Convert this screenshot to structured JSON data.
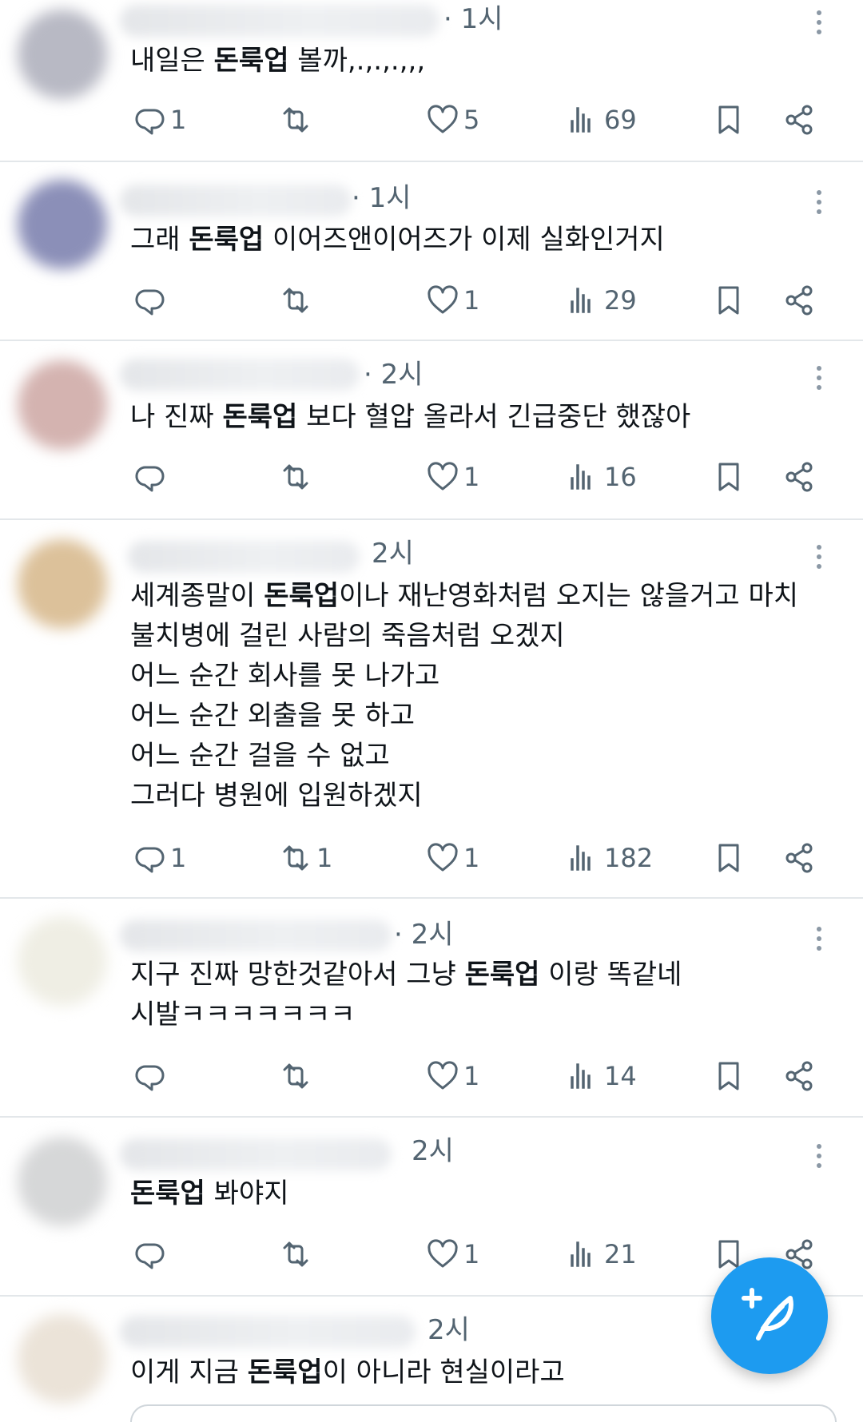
{
  "tweets": [
    {
      "time": "· 1시",
      "text_before": "내일은 ",
      "keyword": "돈룩업",
      "text_after": " 볼까,.,.,.,,,",
      "replies": "1",
      "retweets": "",
      "likes": "5",
      "views": "69"
    },
    {
      "time": "· 1시",
      "text_before": "그래 ",
      "keyword": "돈룩업",
      "text_after": " 이어즈앤이어즈가 이제 실화인거지",
      "replies": "",
      "retweets": "",
      "likes": "1",
      "views": "29"
    },
    {
      "time": "· 2시",
      "text_before": "나 진짜 ",
      "keyword": "돈룩업",
      "text_after": " 보다 혈압 올라서 긴급중단 했잖아",
      "replies": "",
      "retweets": "",
      "likes": "1",
      "views": "16"
    },
    {
      "time": "2시",
      "text_before": "세계종말이 ",
      "keyword": "돈룩업",
      "text_after": "이나 재난영화처럼 오지는 않을거고 마치\n불치병에 걸린 사람의 죽음처럼 오겠지\n어느 순간 회사를 못 나가고\n어느 순간 외출을 못 하고\n어느 순간 걸을 수 없고\n그러다 병원에 입원하겠지",
      "replies": "1",
      "retweets": "1",
      "likes": "1",
      "views": "182"
    },
    {
      "time": "· 2시",
      "text_before": "지구 진짜 망한것같아서 그냥 ",
      "keyword": "돈룩업",
      "text_after": " 이랑 똑같네\n시발ㅋㅋㅋㅋㅋㅋㅋ",
      "replies": "",
      "retweets": "",
      "likes": "1",
      "views": "14"
    },
    {
      "time": "2시",
      "text_before": "",
      "keyword": "돈룩업",
      "text_after": " 봐야지",
      "replies": "",
      "retweets": "",
      "likes": "1",
      "views": "21"
    },
    {
      "time": "2시",
      "text_before": "이게 지금 ",
      "keyword": "돈룩업",
      "text_after": "이 아니라 현실이라고",
      "replies": "",
      "retweets": "",
      "likes": "",
      "views": ""
    }
  ],
  "icons": {
    "reply": "reply-icon",
    "retweet": "retweet-icon",
    "like": "heart-icon",
    "views": "views-icon",
    "bookmark": "bookmark-icon",
    "share": "share-icon",
    "compose": "compose-feather-icon"
  },
  "colors": {
    "accent": "#1d9bf0",
    "muted": "#536471",
    "divider": "#e3e7ea"
  }
}
